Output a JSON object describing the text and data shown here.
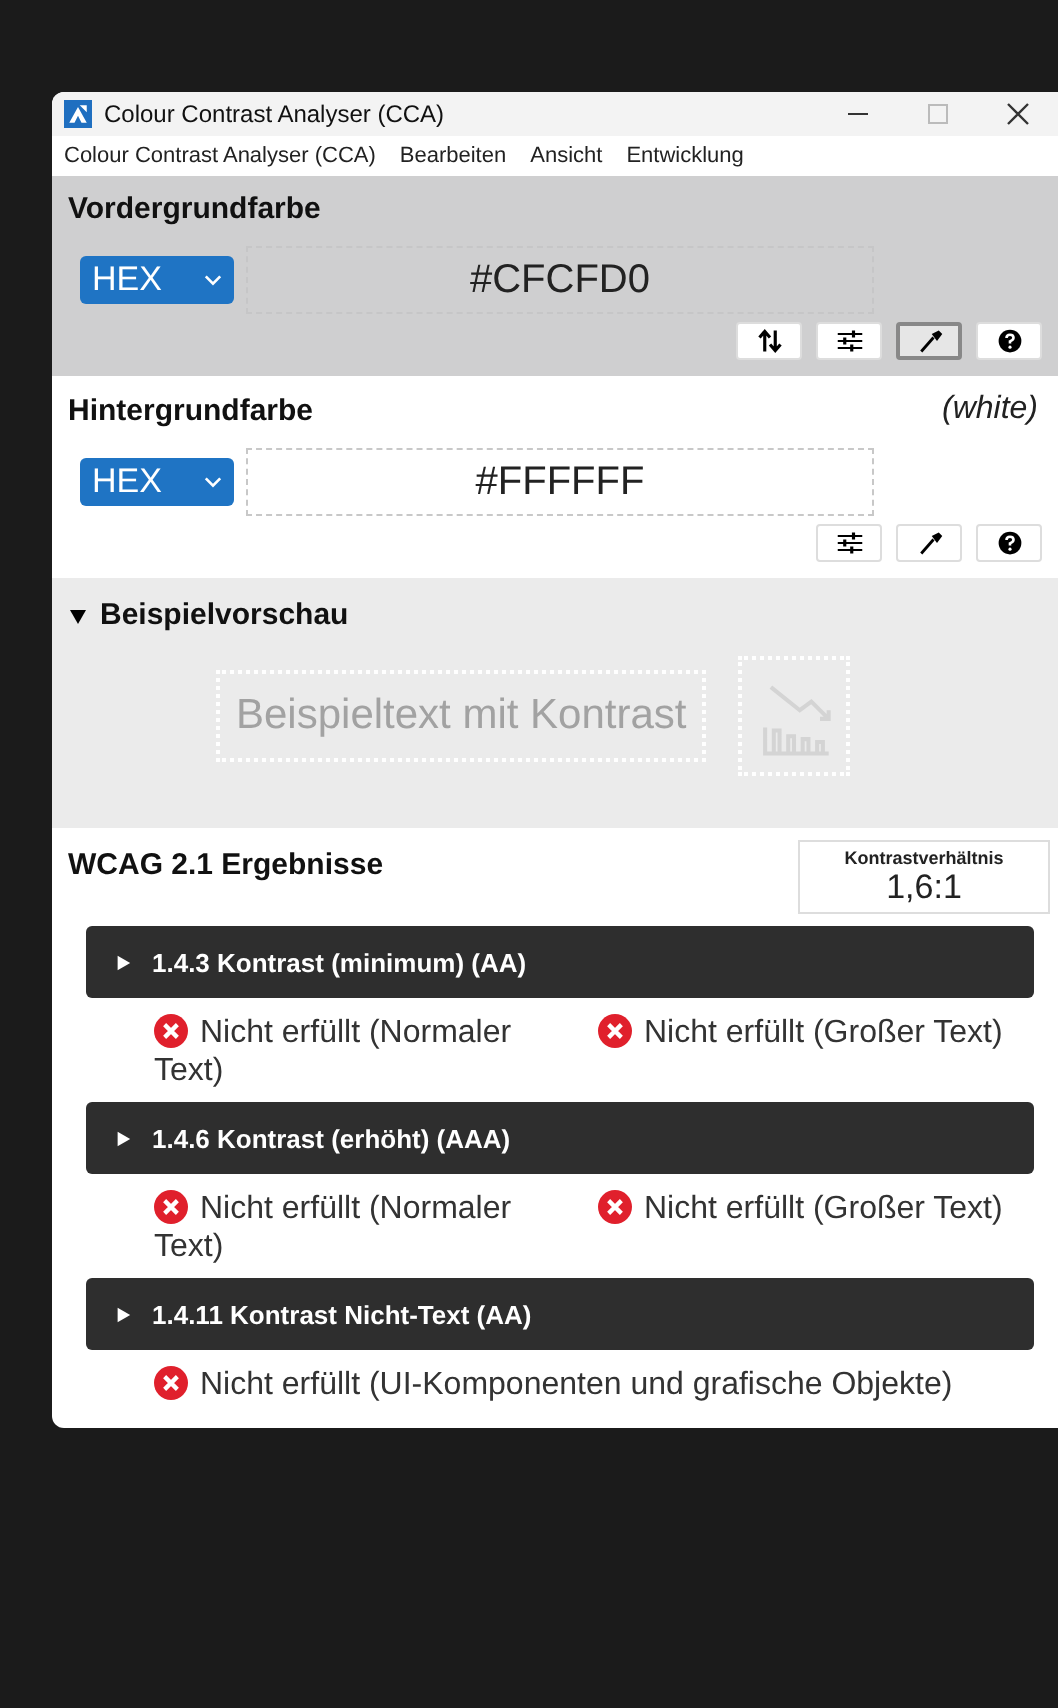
{
  "window": {
    "title": "Colour Contrast Analyser (CCA)"
  },
  "menu": [
    "Colour Contrast Analyser (CCA)",
    "Bearbeiten",
    "Ansicht",
    "Entwicklung"
  ],
  "foreground": {
    "title": "Vordergrundfarbe",
    "format": "HEX",
    "value": "#CFCFD0",
    "tools": [
      {
        "kind": "swap",
        "selected": false
      },
      {
        "kind": "sliders",
        "selected": false
      },
      {
        "kind": "eyedropper",
        "selected": true
      },
      {
        "kind": "help",
        "selected": false
      }
    ]
  },
  "background": {
    "title": "Hintergrundfarbe",
    "name": "(white)",
    "format": "HEX",
    "value": "#FFFFFF",
    "tools": [
      {
        "kind": "sliders",
        "selected": false
      },
      {
        "kind": "eyedropper",
        "selected": false
      },
      {
        "kind": "help",
        "selected": false
      }
    ]
  },
  "preview": {
    "title": "Beispielvorschau",
    "expanded": true,
    "sample": "Beispieltext mit Kontrast"
  },
  "results": {
    "title": "WCAG 2.1 Ergebnisse",
    "ratio_label": "Kontrastverhältnis",
    "ratio": "1,6:1",
    "criteria": [
      {
        "title": "1.4.3 Kontrast (minimum) (AA)",
        "expanded": false,
        "checks": [
          {
            "text": "Nicht erfüllt (Normaler Text)",
            "passed": false
          },
          {
            "text": "Nicht erfüllt (Großer Text)",
            "passed": false
          }
        ]
      },
      {
        "title": "1.4.6 Kontrast (erhöht) (AAA)",
        "expanded": false,
        "checks": [
          {
            "text": "Nicht erfüllt (Normaler Text)",
            "passed": false
          },
          {
            "text": "Nicht erfüllt (Großer Text)",
            "passed": false
          }
        ]
      },
      {
        "title": "1.4.11 Kontrast Nicht-Text (AA)",
        "expanded": false,
        "checks": [
          {
            "text": "Nicht erfüllt (UI-Komponenten und grafische Objekte)",
            "passed": false
          }
        ]
      }
    ]
  }
}
